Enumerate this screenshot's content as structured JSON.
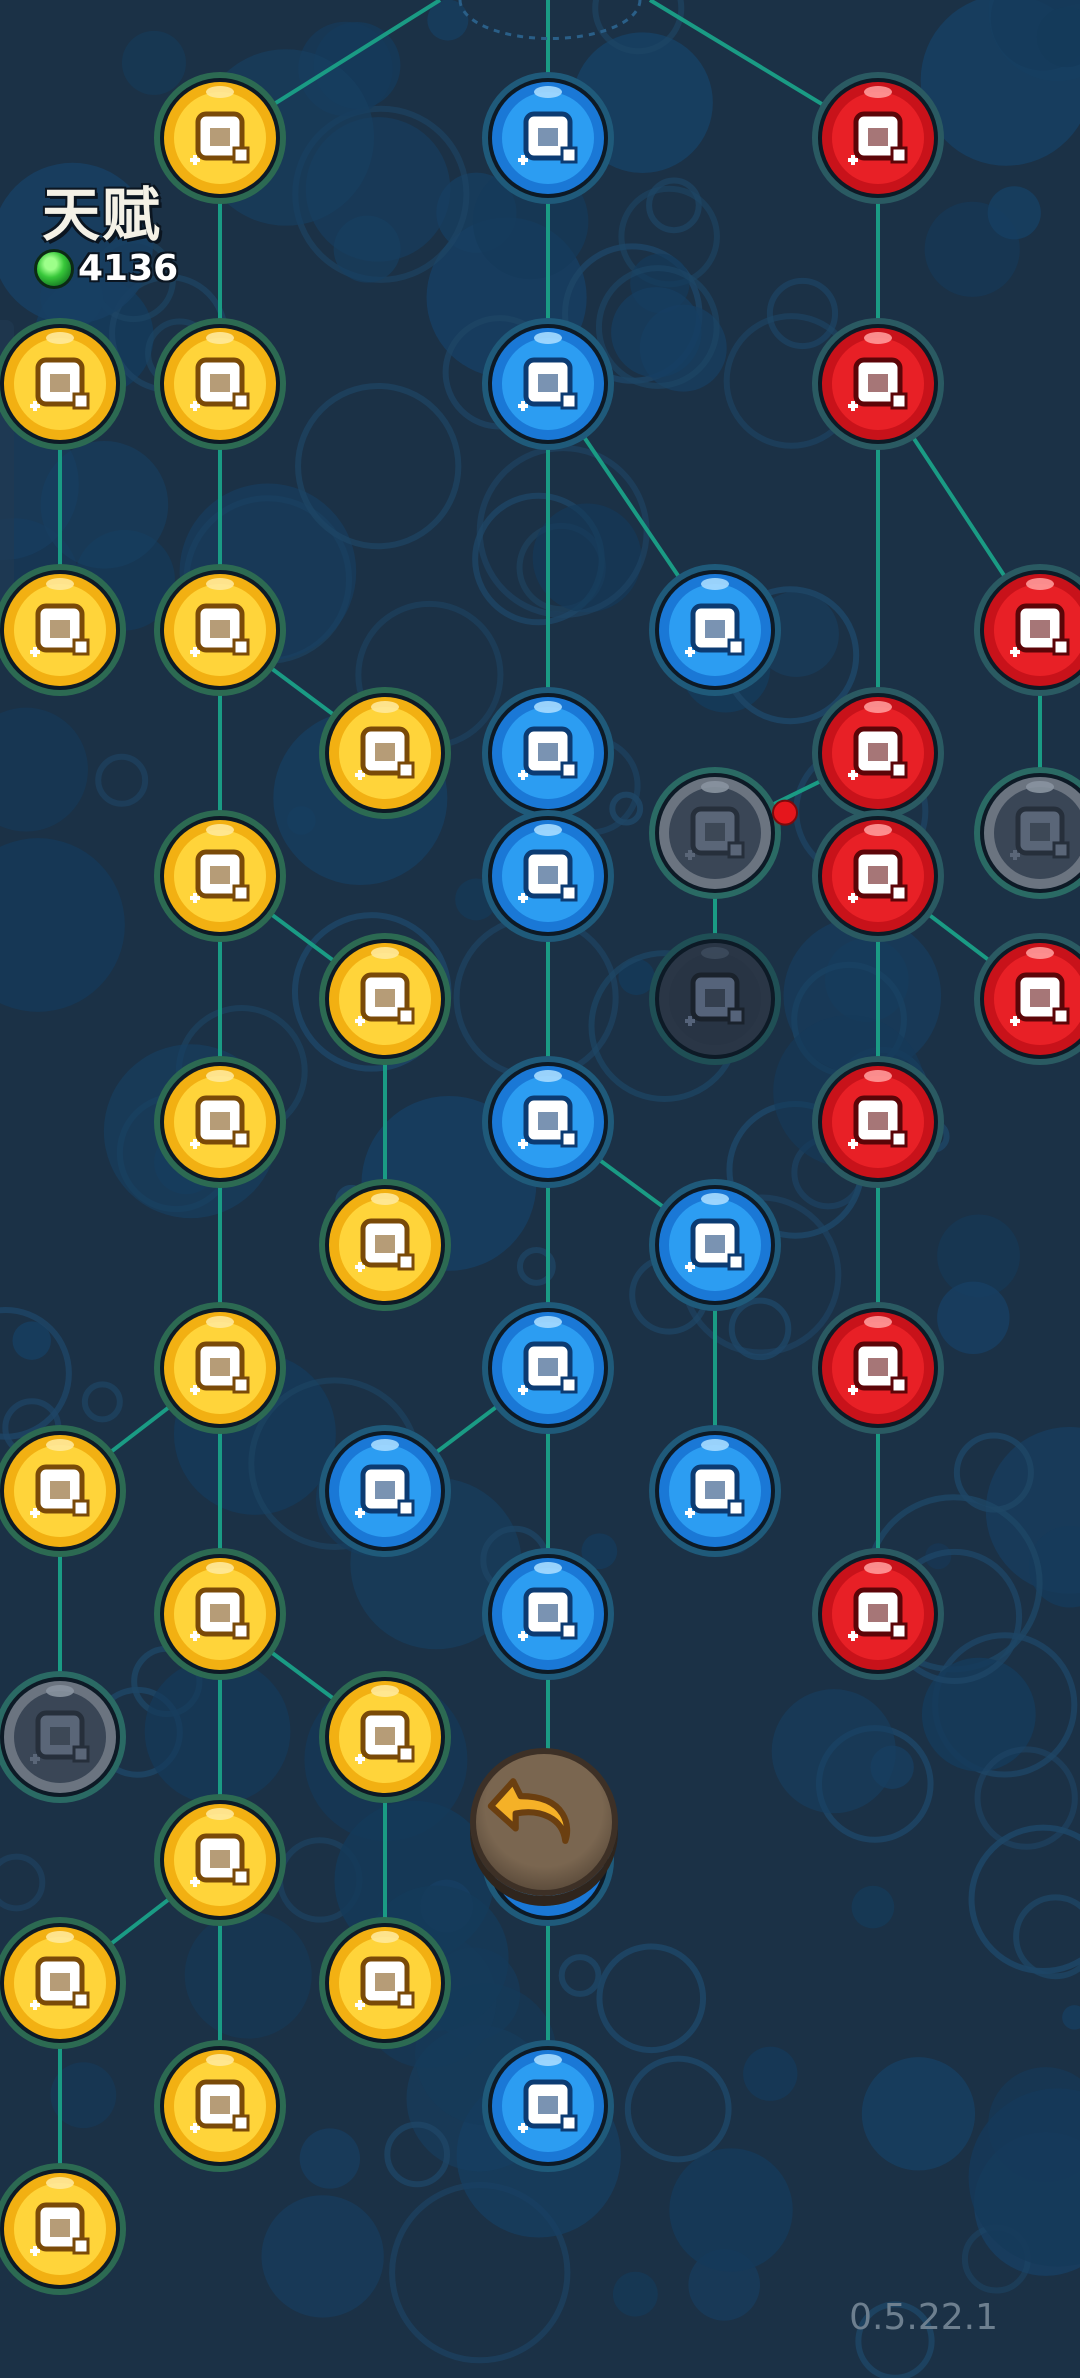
{
  "header": {
    "title": "天赋",
    "currency_icon": "green-gem-icon",
    "currency_count": "4136"
  },
  "version": "0.5.22.1",
  "back_button": {
    "icon": "undo-arrow-icon"
  },
  "colors": {
    "gold": "#f2b012",
    "blue": "#1e86e6",
    "red": "#d9161d",
    "locked": "#303d4d",
    "line": "#1a9b84",
    "notification": "#e5161c"
  },
  "tree": {
    "columns": [
      60,
      220,
      385,
      548,
      715,
      878,
      1040
    ],
    "rows": [
      138,
      384,
      630,
      753,
      876,
      999,
      1122,
      1245,
      1368,
      1491,
      1614,
      1737,
      1860,
      1983,
      2106,
      2229
    ],
    "nodes": [
      {
        "id": "g1",
        "col": 1,
        "row": 0,
        "type": "gold",
        "icon": "crystal-icon"
      },
      {
        "id": "g2",
        "col": 0,
        "row": 1,
        "type": "gold",
        "icon": "crystal-icon",
        "partial": true
      },
      {
        "id": "g3",
        "col": 1,
        "row": 1,
        "type": "gold",
        "icon": "armor-upgrade-icon"
      },
      {
        "id": "g4",
        "col": 0,
        "row": 2,
        "type": "gold",
        "icon": "crystal-icon"
      },
      {
        "id": "g5",
        "col": 1,
        "row": 2,
        "type": "gold",
        "icon": "boots-icon"
      },
      {
        "id": "g6",
        "col": 2,
        "row": 3,
        "type": "gold",
        "icon": "house-up-icon"
      },
      {
        "id": "g7",
        "col": 1,
        "row": 4,
        "type": "gold",
        "icon": "tower-icon"
      },
      {
        "id": "g8",
        "col": 2,
        "row": 5,
        "type": "gold",
        "icon": "tower-icon"
      },
      {
        "id": "g9",
        "col": 1,
        "row": 6,
        "type": "gold",
        "icon": "house-shield-icon"
      },
      {
        "id": "g10",
        "col": 2,
        "row": 7,
        "type": "gold",
        "icon": "tower-icon"
      },
      {
        "id": "g11",
        "col": 1,
        "row": 8,
        "type": "gold",
        "icon": "temple-icon"
      },
      {
        "id": "g12",
        "col": 0,
        "row": 9,
        "type": "gold",
        "icon": "temple-icon"
      },
      {
        "id": "g13",
        "col": 1,
        "row": 10,
        "type": "gold",
        "icon": "house-plus-icon"
      },
      {
        "id": "g14",
        "col": 0,
        "row": 11,
        "type": "locked",
        "icon": "temple-icon"
      },
      {
        "id": "g15",
        "col": 2,
        "row": 11,
        "type": "gold",
        "icon": "house-plus-icon"
      },
      {
        "id": "g16",
        "col": 1,
        "row": 12,
        "type": "gold",
        "icon": "lab-icon"
      },
      {
        "id": "g17",
        "col": 0,
        "row": 13,
        "type": "gold",
        "icon": "lab-icon"
      },
      {
        "id": "g18",
        "col": 2,
        "row": 13,
        "type": "gold",
        "icon": "house-plus-icon"
      },
      {
        "id": "g19",
        "col": 1,
        "row": 14,
        "type": "gold",
        "icon": "barn-icon"
      },
      {
        "id": "g20",
        "col": 0,
        "row": 15,
        "type": "gold",
        "icon": "lab-icon"
      },
      {
        "id": "b1",
        "col": 3,
        "row": 0,
        "type": "blue",
        "icon": "barrel-icon"
      },
      {
        "id": "b2",
        "col": 3,
        "row": 1,
        "type": "blue",
        "icon": "pickaxe-e-icon"
      },
      {
        "id": "b3",
        "col": 4,
        "row": 2,
        "type": "blue",
        "icon": "pickaxe-e-icon"
      },
      {
        "id": "b4",
        "col": 3,
        "row": 3,
        "type": "blue",
        "icon": "chest-icon"
      },
      {
        "id": "b5",
        "col": 3,
        "row": 4,
        "type": "blue",
        "icon": "workers-icon"
      },
      {
        "id": "b6",
        "col": 3,
        "row": 6,
        "type": "blue",
        "icon": "pickaxe-icon"
      },
      {
        "id": "b7",
        "col": 4,
        "row": 7,
        "type": "blue",
        "icon": "pickaxe-icon"
      },
      {
        "id": "b8",
        "col": 3,
        "row": 8,
        "type": "blue",
        "icon": "ore-icon"
      },
      {
        "id": "b9",
        "col": 2,
        "row": 9,
        "type": "blue",
        "icon": "ore-icon"
      },
      {
        "id": "b10",
        "col": 4,
        "row": 9,
        "type": "blue",
        "icon": "pickaxe-icon"
      },
      {
        "id": "b11",
        "col": 3,
        "row": 10,
        "type": "blue",
        "icon": "storage-icon"
      },
      {
        "id": "b12",
        "col": 3,
        "row": 12,
        "type": "blue",
        "icon": "hidden-node-icon"
      },
      {
        "id": "b13",
        "col": 3,
        "row": 14,
        "type": "blue",
        "icon": "magnifier-icon"
      },
      {
        "id": "r1",
        "col": 5,
        "row": 0,
        "type": "red",
        "icon": "skull-e-icon"
      },
      {
        "id": "r2",
        "col": 5,
        "row": 1,
        "type": "red",
        "icon": "skull-drop-icon"
      },
      {
        "id": "r3",
        "col": 6,
        "row": 2,
        "type": "red",
        "icon": "skull-drop-icon"
      },
      {
        "id": "r4",
        "col": 5,
        "row": 3,
        "type": "red",
        "icon": "skull-gem-icon"
      },
      {
        "id": "l1",
        "col": 4,
        "row": 3.65,
        "type": "locked",
        "icon": "skull-icon"
      },
      {
        "id": "l2",
        "col": 6,
        "row": 3.65,
        "type": "locked",
        "icon": "skull-icon"
      },
      {
        "id": "r5",
        "col": 5,
        "row": 4,
        "type": "red",
        "icon": "blood-drop-icon"
      },
      {
        "id": "l3",
        "col": 4,
        "row": 5,
        "type": "locked-dark",
        "icon": "skull-icon"
      },
      {
        "id": "r6",
        "col": 6,
        "row": 5,
        "type": "red",
        "icon": "blood-drop-icon"
      },
      {
        "id": "r7",
        "col": 5,
        "row": 6,
        "type": "red",
        "icon": "skull-banner-icon"
      },
      {
        "id": "r8",
        "col": 5,
        "row": 8,
        "type": "red",
        "icon": "meat-sword-icon"
      },
      {
        "id": "r9",
        "col": 5,
        "row": 10,
        "type": "red",
        "icon": "no-drop-icon"
      }
    ],
    "edges": [
      [
        "g1",
        "g3"
      ],
      [
        "g3",
        "g5"
      ],
      [
        "g5",
        "g6"
      ],
      [
        "g5",
        "g7"
      ],
      [
        "g7",
        "g8"
      ],
      [
        "g8",
        "g10"
      ],
      [
        "g7",
        "g9"
      ],
      [
        "g9",
        "g11"
      ],
      [
        "g11",
        "g12"
      ],
      [
        "g11",
        "g13"
      ],
      [
        "g12",
        "g14"
      ],
      [
        "g13",
        "g15"
      ],
      [
        "g13",
        "g16"
      ],
      [
        "g15",
        "g18"
      ],
      [
        "g16",
        "g17"
      ],
      [
        "g16",
        "g19"
      ],
      [
        "g17",
        "g20"
      ],
      [
        "g2",
        "g4"
      ],
      [
        "b1",
        "b2"
      ],
      [
        "b2",
        "b3"
      ],
      [
        "b2",
        "b4"
      ],
      [
        "b4",
        "b5"
      ],
      [
        "b5",
        "b6"
      ],
      [
        "b6",
        "b7"
      ],
      [
        "b6",
        "b8"
      ],
      [
        "b7",
        "b10"
      ],
      [
        "b8",
        "b9"
      ],
      [
        "b8",
        "b11"
      ],
      [
        "b11",
        "b12"
      ],
      [
        "b12",
        "b13"
      ],
      [
        "r1",
        "r2"
      ],
      [
        "r2",
        "r3"
      ],
      [
        "r2",
        "r4"
      ],
      [
        "r4",
        "l1"
      ],
      [
        "r3",
        "l2"
      ],
      [
        "r4",
        "r5"
      ],
      [
        "l1",
        "l3"
      ],
      [
        "r5",
        "r6"
      ],
      [
        "r5",
        "r7"
      ],
      [
        "r7",
        "r8"
      ],
      [
        "r8",
        "r9"
      ]
    ],
    "top_edges": [
      [
        "g1",
        440,
        0
      ],
      [
        "r1",
        650,
        0
      ],
      [
        "b1",
        548,
        0
      ]
    ],
    "notification_dot": {
      "col": 4,
      "row": 3.55
    }
  }
}
